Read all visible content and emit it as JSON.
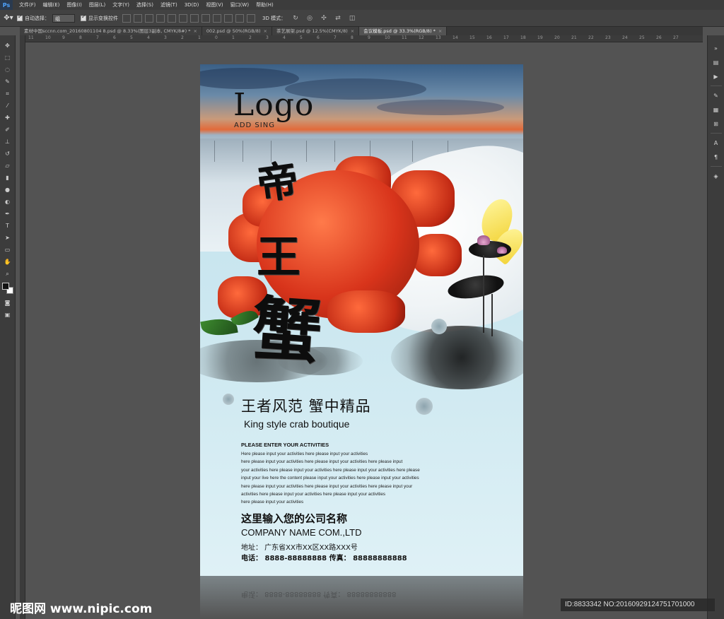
{
  "app": {
    "logo": "Ps",
    "menus": [
      "文件(F)",
      "编辑(E)",
      "图像(I)",
      "图层(L)",
      "文字(Y)",
      "选择(S)",
      "滤镜(T)",
      "3D(D)",
      "视图(V)",
      "窗口(W)",
      "帮助(H)"
    ]
  },
  "options": {
    "auto_select_label": "自动选择：",
    "auto_select_value": "组",
    "show_transform_label": "显示变换控件",
    "mode_3d_label": "3D 模式："
  },
  "tabs": [
    {
      "label": "素材中国sccnn.com_20160801104 8.psd @ 8.33%(图层3副本, CMYK/8#) *"
    },
    {
      "label": "002.psd @ 50%(RGB/8)"
    },
    {
      "label": "茶艺展架.psd @ 12.5%(CMYK/8)"
    },
    {
      "label": "会议模板.psd @ 33.3%(RGB/8) *"
    }
  ],
  "ruler_ticks": [
    "11",
    "10",
    "9",
    "8",
    "7",
    "6",
    "5",
    "4",
    "3",
    "2",
    "1",
    "0",
    "1",
    "2",
    "3",
    "4",
    "5",
    "6",
    "7",
    "8",
    "9",
    "10",
    "11",
    "12",
    "13",
    "14",
    "15",
    "16",
    "17",
    "18",
    "19",
    "20",
    "21",
    "22",
    "23",
    "24",
    "25",
    "26",
    "27"
  ],
  "poster": {
    "logo": "Logo",
    "logo_sub": "ADD SING",
    "callig_1": "帝",
    "callig_2": "王",
    "callig_3": "蟹",
    "slogan_cn": "王者风范  蟹中精品",
    "slogan_en": "King style crab boutique",
    "activities_title": "PLEASE ENTER YOUR ACTIVITIES",
    "activities_lines": [
      "Here please input your activities here please input your activities",
      "here please input your activities here please input your activities here please input",
      "your activities here please input your activities here please input your activities here please",
      "input your live here the content please input your activities here please input your activities",
      "here please input your activities here please input your activities here please input your",
      " activities here please input your activities here please input your activities",
      "here please input your activities"
    ],
    "company_cn": "这里输入您的公司名称",
    "company_en": "COMPANY NAME COM.,LTD",
    "address": "地址：  广东省XX市XX区XX路XXX号",
    "phone": "电话：  8888-88888888   传真：  88888888888"
  },
  "watermark": {
    "left": "昵图网 www.nipic.com",
    "right": "ID:8833342 NO:20160929124751701000"
  }
}
